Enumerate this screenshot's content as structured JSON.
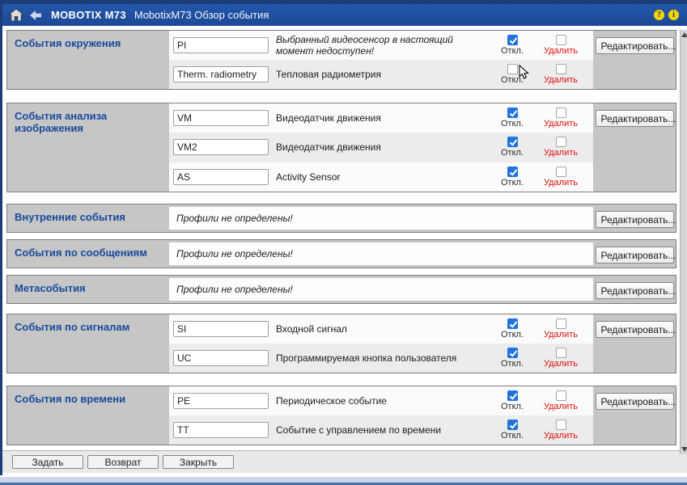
{
  "header": {
    "brand": "MOBOTIX M73",
    "page_title": "MobotixM73 Обзор события",
    "help_icon": "?",
    "info_icon": "i"
  },
  "labels": {
    "off": "Откл.",
    "delete": "Удалить",
    "edit": "Редактировать..."
  },
  "colors": {
    "titlebar_blue": "#1c4896",
    "frame_navy": "#1d3d79",
    "section_gray": "#c6c6c6",
    "section_title_blue": "#19499c",
    "delete_red": "#e01010",
    "checkbox_blue": "#2273dc",
    "icon_yellow": "#f6d600"
  },
  "sections": [
    {
      "title": "События окружения",
      "rows": [
        {
          "tag": "PI",
          "desc": "Выбранный видеосенсор в настоящий момент недоступен!",
          "italic": true,
          "off": true,
          "delete": false
        },
        {
          "tag": "Therm. radiometry",
          "desc": "Тепловая радиометрия",
          "italic": false,
          "off": false,
          "delete": false
        }
      ]
    },
    {
      "title": "События анализа изображения",
      "rows": [
        {
          "tag": "VM",
          "desc": "Видеодатчик движения",
          "italic": false,
          "off": true,
          "delete": false
        },
        {
          "tag": "VM2",
          "desc": "Видеодатчик движения",
          "italic": false,
          "off": true,
          "delete": false
        },
        {
          "tag": "AS",
          "desc": "Activity Sensor",
          "italic": false,
          "off": true,
          "delete": false
        }
      ]
    },
    {
      "title": "Внутренние события",
      "message": "Профили не определены!"
    },
    {
      "title": "События по сообщениям",
      "message": "Профили не определены!"
    },
    {
      "title": "Метасобытия",
      "message": "Профили не определены!"
    },
    {
      "title": "События по сигналам",
      "rows": [
        {
          "tag": "SI",
          "desc": "Входной сигнал",
          "italic": false,
          "off": true,
          "delete": false
        },
        {
          "tag": "UC",
          "desc": "Программируемая кнопка пользователя",
          "italic": false,
          "off": true,
          "delete": false
        }
      ]
    },
    {
      "title": "События по времени",
      "rows": [
        {
          "tag": "PE",
          "desc": "Периодическое событие",
          "italic": false,
          "off": true,
          "delete": false
        },
        {
          "tag": "TT",
          "desc": "Событие с управлением по времени",
          "italic": false,
          "off": true,
          "delete": false
        }
      ]
    }
  ],
  "footer": {
    "set": "Задать",
    "restore": "Возврат",
    "close": "Закрыть"
  }
}
